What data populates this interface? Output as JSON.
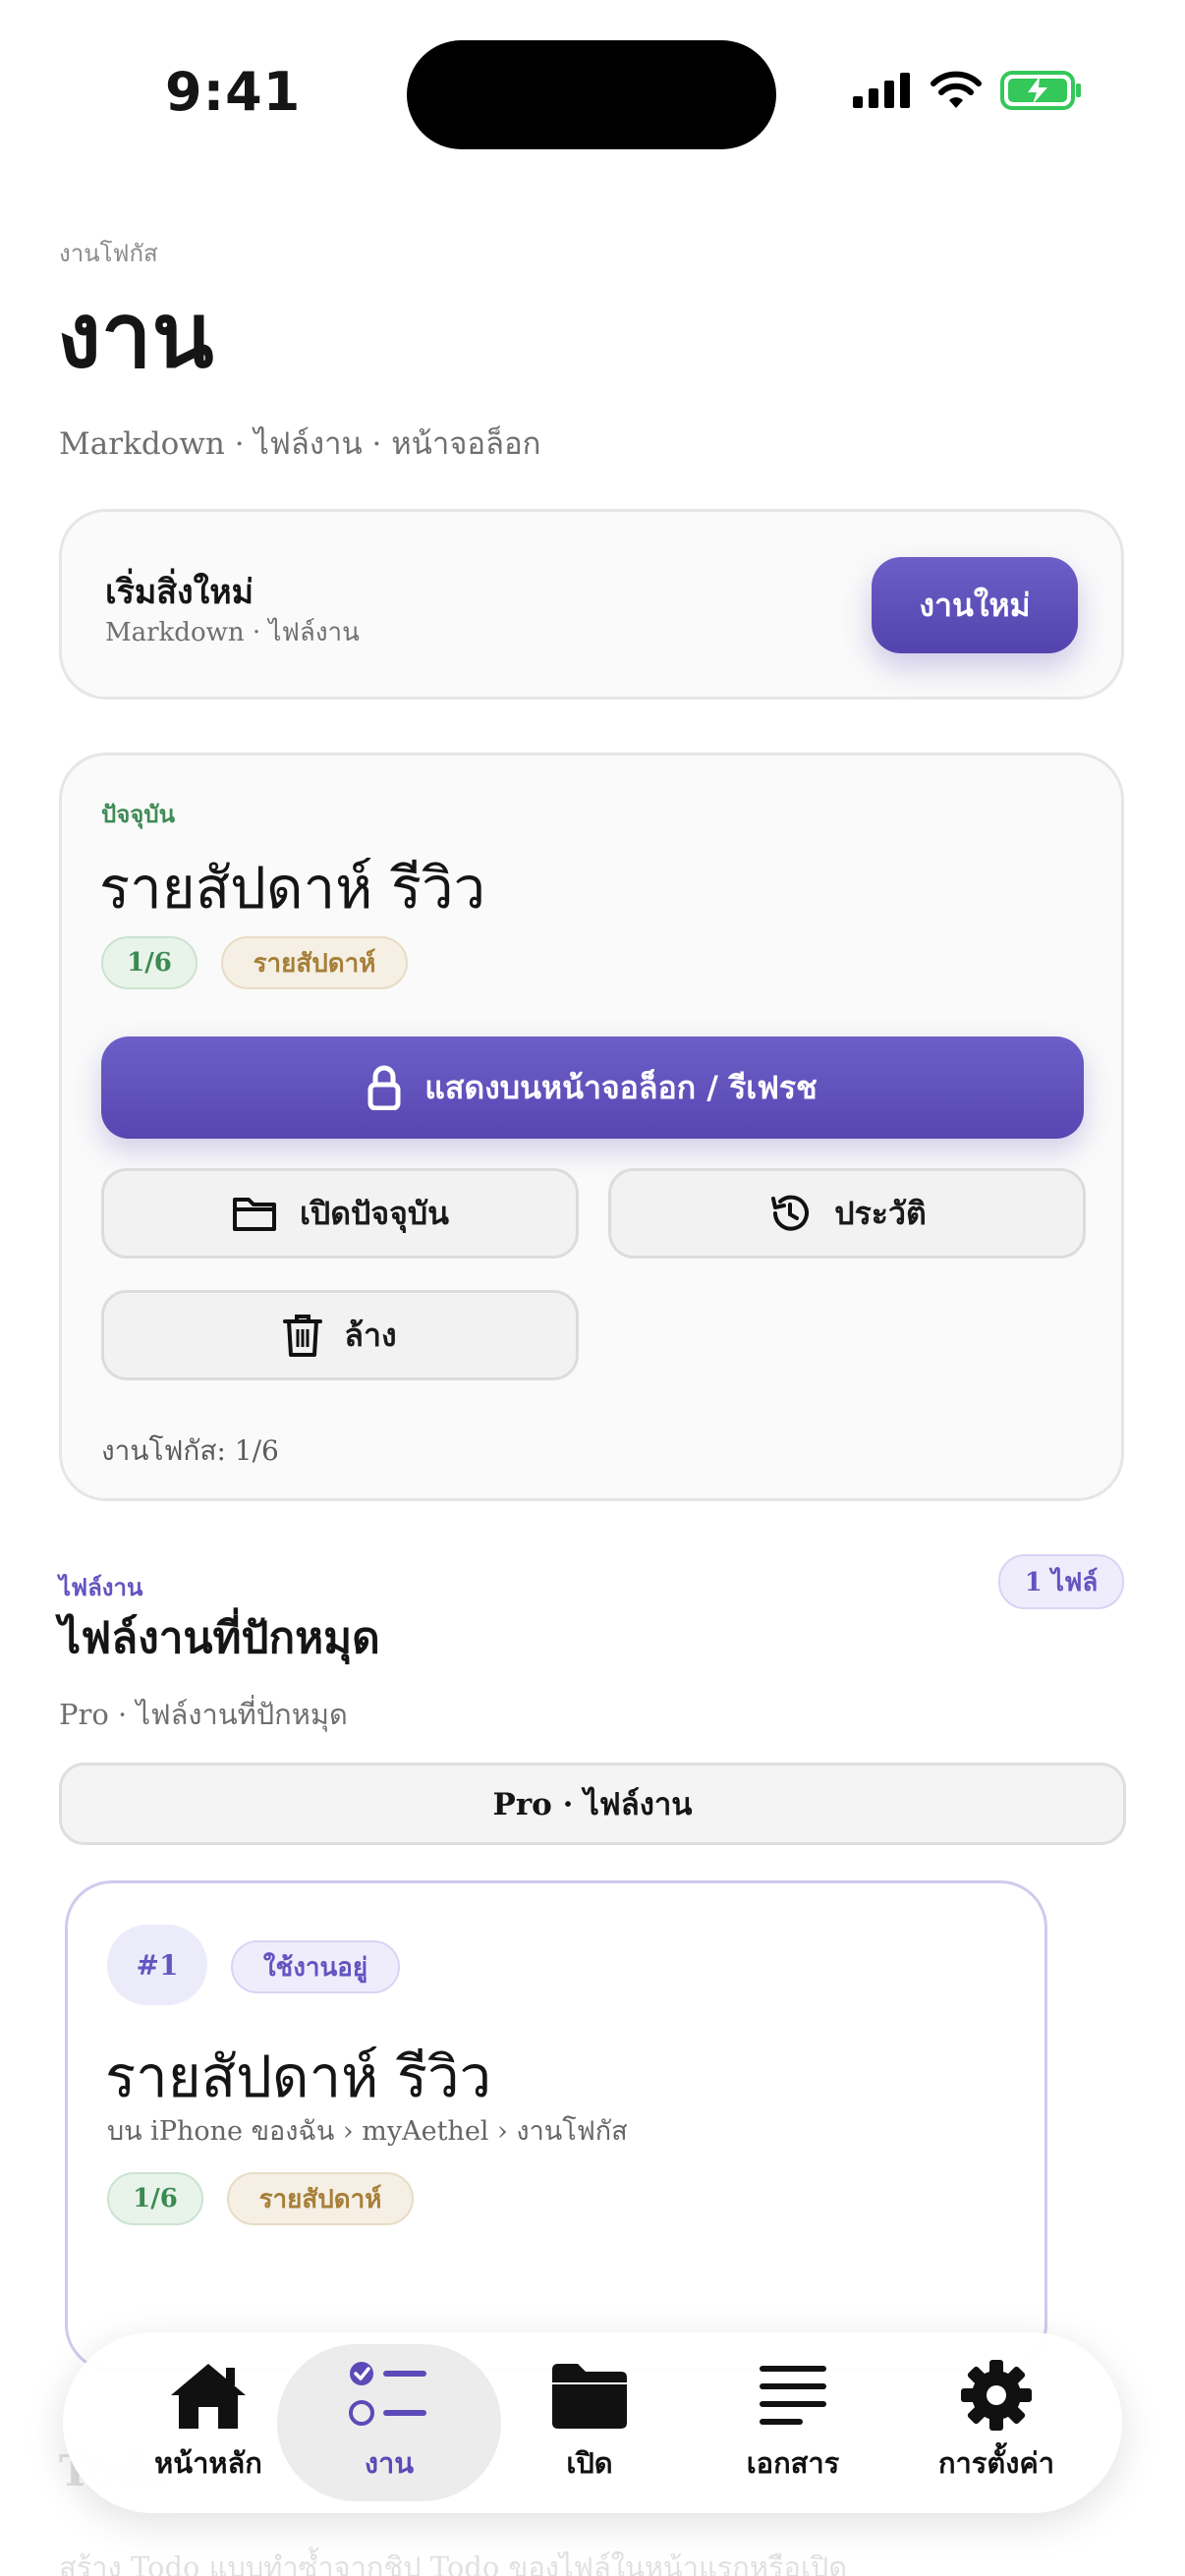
{
  "status": {
    "time": "9:41"
  },
  "header": {
    "eyebrow": "งานโฟกัส",
    "title": "งาน",
    "subtitle": "Markdown · ไฟล์งาน · หน้าจอล็อก"
  },
  "start_card": {
    "title": "เริ่มสิ่งใหม่",
    "subtitle": "Markdown · ไฟล์งาน",
    "button_label": "งานใหม่"
  },
  "current_card": {
    "eyebrow": "ปัจจุบัน",
    "title": "รายสัปดาห์ รีวิว",
    "progress_badge": "1/6",
    "frequency_badge": "รายสัปดาห์",
    "primary_button": "แสดงบนหน้าจอล็อก / รีเฟรช",
    "open_button": "เปิดปัจจุบัน",
    "history_button": "ประวัติ",
    "clear_button": "ล้าง",
    "footer": "งานโฟกัส: 1/6"
  },
  "files_section": {
    "eyebrow": "ไฟล์งาน",
    "title": "ไฟล์งานที่ปักหมุด",
    "subtitle": "Pro · ไฟล์งานที่ปักหมุด",
    "count_badge": "1 ไฟล์",
    "pro_bar_label": "Pro · ไฟล์งาน"
  },
  "file_card": {
    "number": "#1",
    "status_badge": "ใช้งานอยู่",
    "title": "รายสัปดาห์ รีวิว",
    "path": "บน iPhone ของฉัน › myAethel › งานโฟกัส",
    "progress_badge": "1/6",
    "frequency_badge": "รายสัปดาห์"
  },
  "todo_section": {
    "title": "Todo",
    "subtitle": "สร้าง Todo แบบทำซ้ำจากชิป Todo ของไฟล์ในหน้าแรกหรือเปิด"
  },
  "tabbar": {
    "items": [
      {
        "label": "หน้าหลัก",
        "icon": "home-icon"
      },
      {
        "label": "งาน",
        "icon": "tasks-icon"
      },
      {
        "label": "เปิด",
        "icon": "folder-icon"
      },
      {
        "label": "เอกสาร",
        "icon": "document-lines-icon"
      },
      {
        "label": "การตั้งค่า",
        "icon": "gear-icon"
      }
    ],
    "active_index": 1
  },
  "colors": {
    "accent": "#5B4BB8",
    "success": "#3B8A52",
    "tan": "#A67F38",
    "battery": "#34C759"
  }
}
